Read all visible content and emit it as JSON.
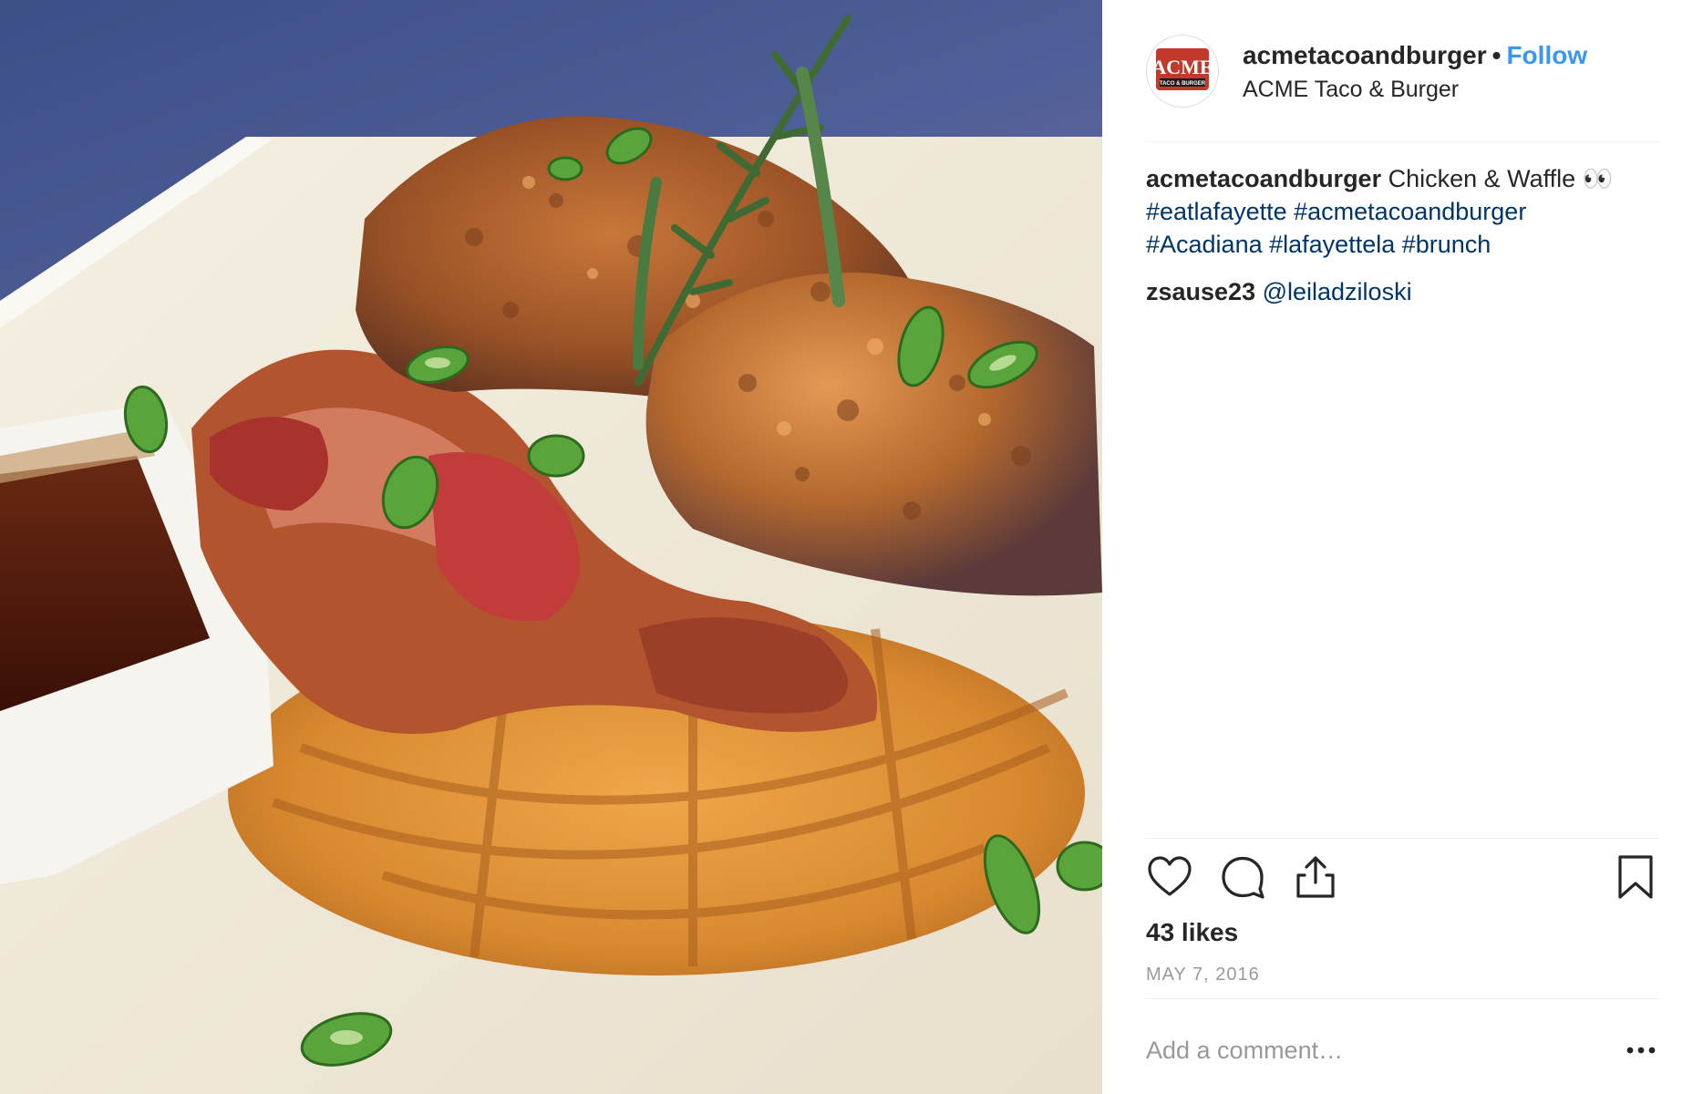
{
  "post": {
    "image_alt": "Chicken and waffle with bacon and syrup"
  },
  "header": {
    "username": "acmetacoandburger",
    "separator": "•",
    "follow_label": "Follow",
    "location": "ACME Taco & Burger",
    "avatar_icon": "acme-taco-burger-logo",
    "avatar_logo_text": "ACME",
    "avatar_logo_subtext": "TACO & BURGER"
  },
  "caption": {
    "username": "acmetacoandburger",
    "text": "Chicken & Waffle 👀",
    "hashtags": [
      "#eatlafayette",
      "#acmetacoandburger",
      "#Acadiana",
      "#lafayettela",
      "#brunch"
    ]
  },
  "comments": [
    {
      "username": "zsause23",
      "mention": "@leiladziloski"
    }
  ],
  "actions": {
    "like_icon": "heart-icon",
    "comment_icon": "comment-bubble-icon",
    "share_icon": "share-icon",
    "save_icon": "bookmark-icon"
  },
  "likes_text": "43 likes",
  "date_text": "MAY 7, 2016",
  "add_comment": {
    "placeholder": "Add a comment…",
    "more_icon": "more-options-icon"
  },
  "colors": {
    "link_blue": "#3897f0",
    "hashtag": "#003569",
    "muted": "#999999",
    "text": "#262626",
    "divider": "#efefef",
    "logo_red": "#c0392b"
  }
}
